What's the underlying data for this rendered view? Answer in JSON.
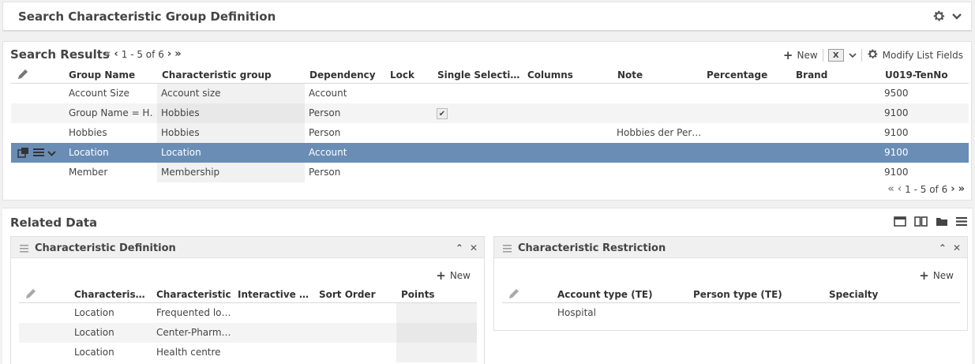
{
  "top": {
    "title": "Search Characteristic Group Definition"
  },
  "results": {
    "title": "Search Results",
    "pager_top": "1 - 5 of 6",
    "pager_bottom": "1 - 5 of 6",
    "toolbar": {
      "new_label": "New",
      "modify_label": "Modify List Fields"
    },
    "columns": [
      "Group Name",
      "Characteristic group",
      "Dependency",
      "Lock",
      "Single Selecti…",
      "Columns",
      "Note",
      "Percentage",
      "Brand",
      "U019-TenNo"
    ],
    "rows": [
      {
        "group_name": "Account Size",
        "char_group": "Account size",
        "dependency": "Account",
        "single_selection": "",
        "note": "",
        "tenno": "9500"
      },
      {
        "group_name": "Group Name = H…",
        "char_group": "Hobbies",
        "dependency": "Person",
        "single_selection": "✔",
        "note": "",
        "tenno": "9100"
      },
      {
        "group_name": "Hobbies",
        "char_group": "Hobbies",
        "dependency": "Person",
        "single_selection": "",
        "note": "Hobbies der Per…",
        "tenno": "9100"
      },
      {
        "group_name": "Location",
        "char_group": "Location",
        "dependency": "Account",
        "single_selection": "",
        "note": "",
        "tenno": "9100"
      },
      {
        "group_name": "Member",
        "char_group": "Membership",
        "dependency": "Person",
        "single_selection": "",
        "note": "",
        "tenno": "9100"
      }
    ],
    "selected_row": 3
  },
  "related": {
    "title": "Related Data",
    "char_def": {
      "title": "Characteristic Definition",
      "new_label": "New",
      "columns": [
        "Characteris…",
        "Characteristic",
        "Interactive …",
        "Sort Order",
        "Points"
      ],
      "rows": [
        {
          "group": "Location",
          "characteristic": "Frequented lo…"
        },
        {
          "group": "Location",
          "characteristic": "Center-Pharm…"
        },
        {
          "group": "Location",
          "characteristic": "Health centre"
        }
      ]
    },
    "char_restr": {
      "title": "Characteristic Restriction",
      "new_label": "New",
      "columns": [
        "Account type (TE)",
        "Person type (TE)",
        "Specialty"
      ],
      "rows": [
        {
          "account_type": "Hospital"
        }
      ]
    }
  },
  "colors": {
    "selected_row": "#6a8db6",
    "alt_row": "#f4f4f4",
    "shaded_col": "#ececec"
  }
}
